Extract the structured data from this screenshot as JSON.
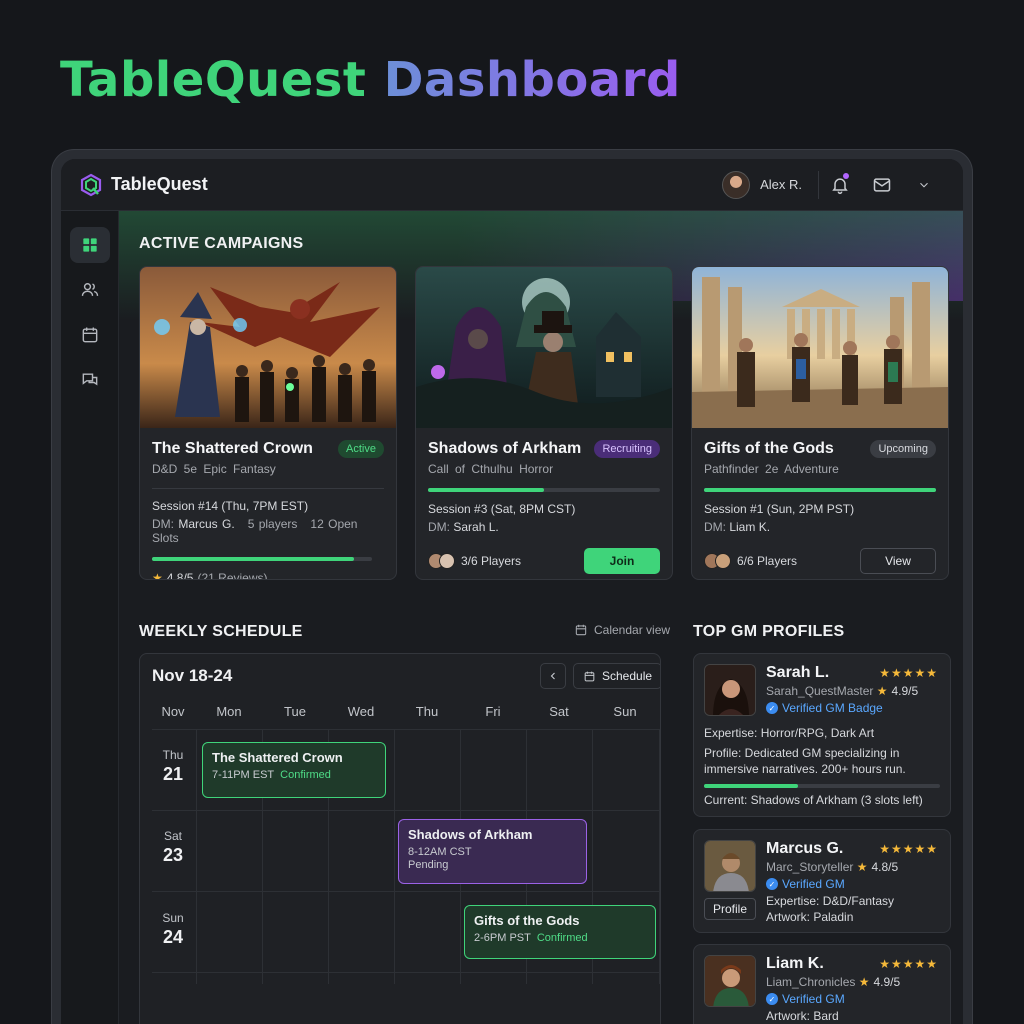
{
  "hero": {
    "word1": "TableQuest",
    "word2": "Dashboard"
  },
  "app": {
    "name": "TableQuest"
  },
  "user": {
    "name": "Alex R."
  },
  "icons": {
    "sidebar": [
      "dashboard-icon",
      "users-icon",
      "calendar-icon",
      "chat-icon"
    ],
    "topbar": [
      "bell-icon",
      "mail-icon",
      "chevron-down-icon"
    ]
  },
  "colors": {
    "accent_green": "#3fd47a",
    "accent_purple": "#9b62e6",
    "pending_yellow": "#f3c346"
  },
  "sections": {
    "active_campaigns": "ACTIVE CAMPAIGNS",
    "weekly_schedule": "WEEKLY SCHEDULE",
    "top_gm": "TOP GM PROFILES",
    "calendar_view": "Calendar view"
  },
  "campaigns": [
    {
      "title": "The Shattered Crown",
      "badge": "Active",
      "system": "D&D 5e",
      "genre": "Epic Fantasy",
      "session": "Session #14 (Thu, 7PM EST)",
      "dm_label": "DM:",
      "dm": "Marcus G.",
      "players": "5 players",
      "slots": "12 Open Slots",
      "progress": 0.92,
      "rating": "4.8/5",
      "reviews": "(21 Reviews)"
    },
    {
      "title": "Shadows of Arkham",
      "badge": "Recruiting",
      "system": "Call of Cthulhu",
      "genre": "Horror",
      "session": "Session #3 (Sat, 8PM CST)",
      "dm_label": "DM:",
      "dm": "Sarah L.",
      "progress": 0.5,
      "players": "3/6 Players",
      "button": "Join"
    },
    {
      "title": "Gifts of the Gods",
      "badge": "Upcoming",
      "system": "Pathfinder 2e",
      "genre": "Adventure",
      "session": "Session #1 (Sun, 2PM PST)",
      "dm_label": "DM:",
      "dm": "Liam K.",
      "progress": 1.0,
      "players": "6/6 Players",
      "button": "View"
    }
  ],
  "schedule": {
    "range": "Nov 18-24",
    "button": "Schedule",
    "days": [
      "Nov",
      "Mon",
      "Tue",
      "Wed",
      "Thu",
      "Fri",
      "Sat",
      "Sun"
    ],
    "rows": [
      {
        "dow": "Thu",
        "day": "21"
      },
      {
        "dow": "Sat",
        "day": "23"
      },
      {
        "dow": "Sun",
        "day": "24"
      }
    ],
    "events": [
      {
        "title": "The Shattered Crown",
        "time": "7-11PM EST",
        "status": "Confirmed"
      },
      {
        "title": "Shadows of Arkham",
        "time": "8-12AM CST",
        "status": "Pending"
      },
      {
        "title": "Gifts of the Gods",
        "time": "2-6PM PST",
        "status": "Confirmed"
      }
    ]
  },
  "gms": [
    {
      "name": "Sarah L.",
      "stars": "★★★★★",
      "handle": "Sarah_QuestMaster",
      "score": "4.9/5",
      "verified": "Verified GM Badge",
      "expertise": "Expertise: Horror/RPG, Dark Art",
      "profile_line1": "Profile: Dedicated GM specializing in",
      "profile_line2": "immersive narratives. 200+ hours run.",
      "progress": 0.4,
      "current": "Current: Shadows of Arkham (3 slots left)"
    },
    {
      "name": "Marcus G.",
      "stars": "★★★★★",
      "handle": "Marc_Storyteller",
      "score": "4.8/5",
      "verified": "Verified GM",
      "expertise": "Expertise: D&D/Fantasy",
      "artwork": "Artwork: Paladin",
      "button": "Profile"
    },
    {
      "name": "Liam K.",
      "stars": "★★★★★",
      "handle": "Liam_Chronicles",
      "score": "4.9/5",
      "verified": "Verified GM",
      "artwork": "Artwork: Bard"
    }
  ]
}
